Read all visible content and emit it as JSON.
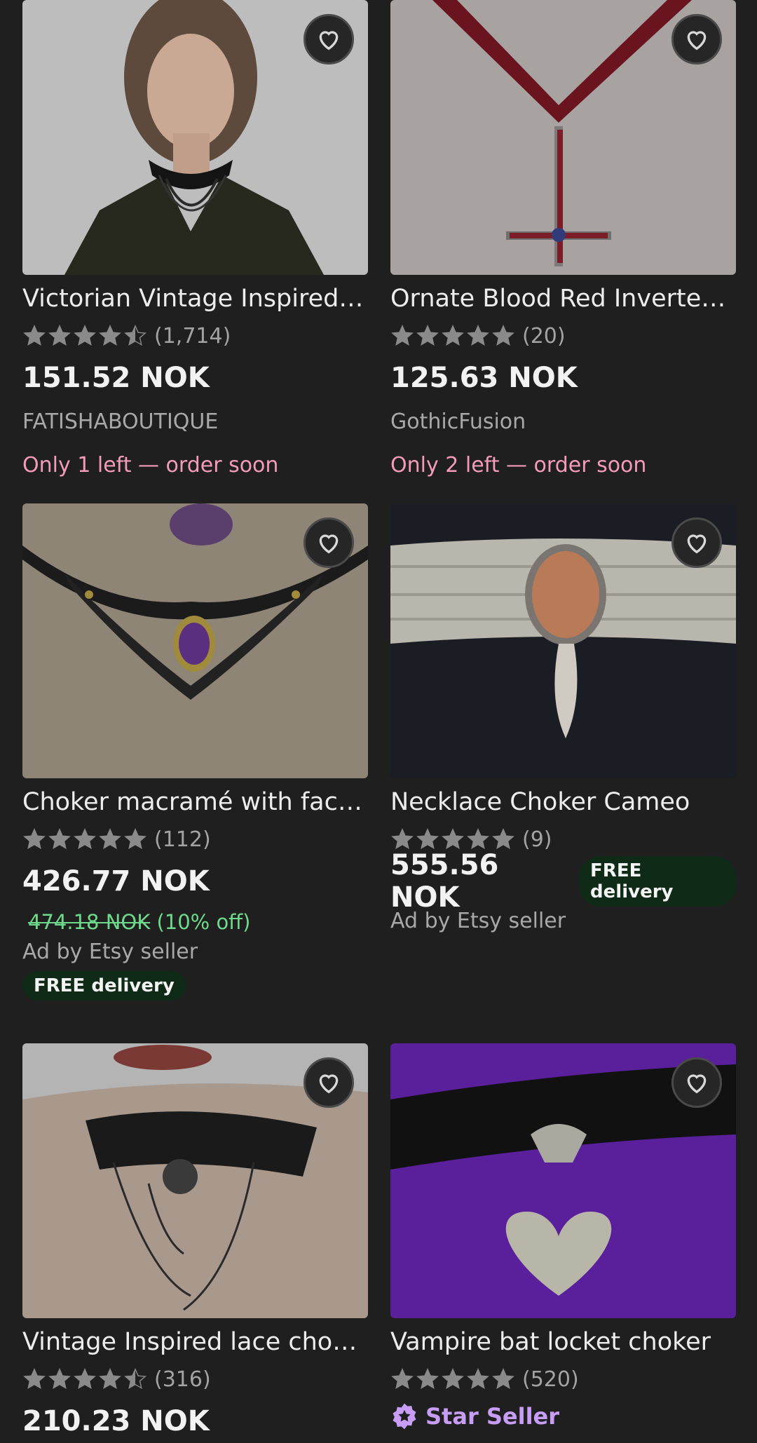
{
  "colors": {
    "background": "#1f1f1f",
    "stock_text": "#f39bb8",
    "discount_text": "#6ed88b",
    "badge_bg": "#0f2a17",
    "star_seller": "#c79df5"
  },
  "products": [
    {
      "title": "Victorian Vintage Inspired ...",
      "rating": 4.5,
      "reviews": "(1,714)",
      "price": "151.52 NOK",
      "shop": "FATISHABOUTIQUE",
      "stock": "Only 1 left — order soon",
      "favorite_icon": "heart-outline-icon"
    },
    {
      "title": "Ornate Blood Red Inverted ...",
      "rating": 5,
      "reviews": "(20)",
      "price": "125.63 NOK",
      "shop": "GothicFusion",
      "stock": "Only 2 left — order soon",
      "favorite_icon": "heart-outline-icon"
    },
    {
      "title": "Choker macramé with face...",
      "rating": 5,
      "reviews": "(112)",
      "price": "426.77 NOK",
      "original_price": "474.18 NOK",
      "discount": "(10% off)",
      "ad_label": "Ad by Etsy seller",
      "delivery_badge": "FREE delivery",
      "favorite_icon": "heart-outline-icon"
    },
    {
      "title": "Necklace Choker Cameo",
      "rating": 5,
      "reviews": "(9)",
      "price": "555.56 NOK",
      "delivery_badge": "FREE delivery",
      "ad_label": "Ad by Etsy seller",
      "favorite_icon": "heart-outline-icon"
    },
    {
      "title": "Vintage Inspired lace chok...",
      "rating": 4.5,
      "reviews": "(316)",
      "price": "210.23 NOK",
      "favorite_icon": "heart-outline-icon"
    },
    {
      "title": "Vampire bat locket choker",
      "rating": 5,
      "reviews": "(520)",
      "star_seller": "Star Seller",
      "favorite_icon": "heart-outline-icon"
    }
  ]
}
